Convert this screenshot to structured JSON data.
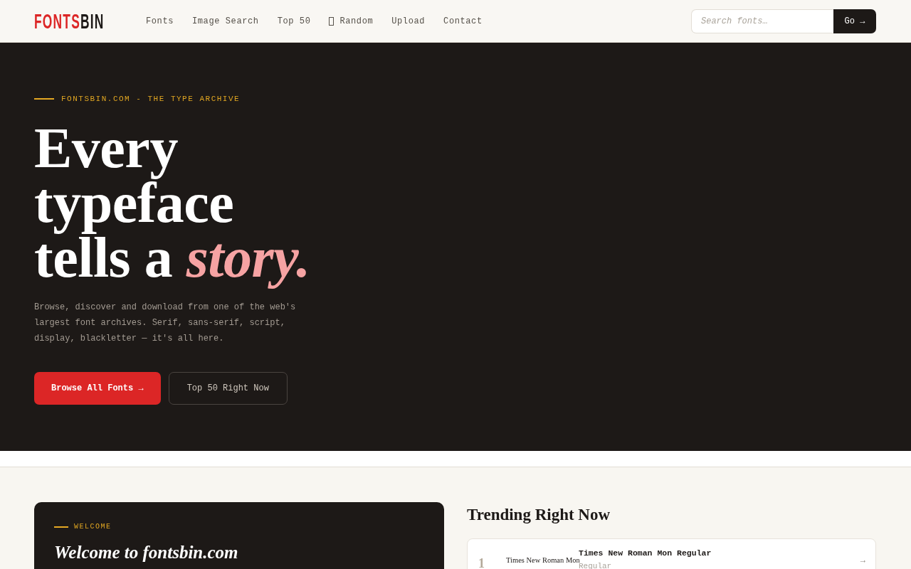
{
  "header": {
    "logo": {
      "accent": "FONTS",
      "rest": "BIN"
    },
    "nav": [
      {
        "label": "Fonts",
        "kind": "link"
      },
      {
        "label": "Image Search",
        "kind": "link"
      },
      {
        "label": "Top 50",
        "kind": "link"
      },
      {
        "label": "Random",
        "kind": "icon_link"
      },
      {
        "label": "Upload",
        "kind": "link"
      },
      {
        "label": "Contact",
        "kind": "link"
      }
    ],
    "search": {
      "placeholder": "Search fonts…",
      "button": "Go →"
    }
  },
  "hero": {
    "eyebrow": "FONTSBIN.COM - THE TYPE ARCHIVE",
    "headline": "Every typeface tells a *story.*",
    "intro": "Browse, discover and download from one of the web's largest font archives. Serif, sans-serif, script, display, blackletter — it's all here.",
    "buttons": [
      {
        "label": "Browse All Fonts →",
        "kind": "primary"
      },
      {
        "label": "Top 50 Right Now",
        "kind": "secondary"
      }
    ]
  },
  "welcome": {
    "eyebrow": "WELCOME",
    "title": "Welcome to fontsbin.com"
  },
  "trending": {
    "title": "Trending Right Now",
    "items": [
      {
        "rank": "1",
        "preview": "Times New Roman Mon",
        "name": "Times New Roman Mon Regular",
        "style": "Regular",
        "arrow": "→"
      }
    ]
  }
}
